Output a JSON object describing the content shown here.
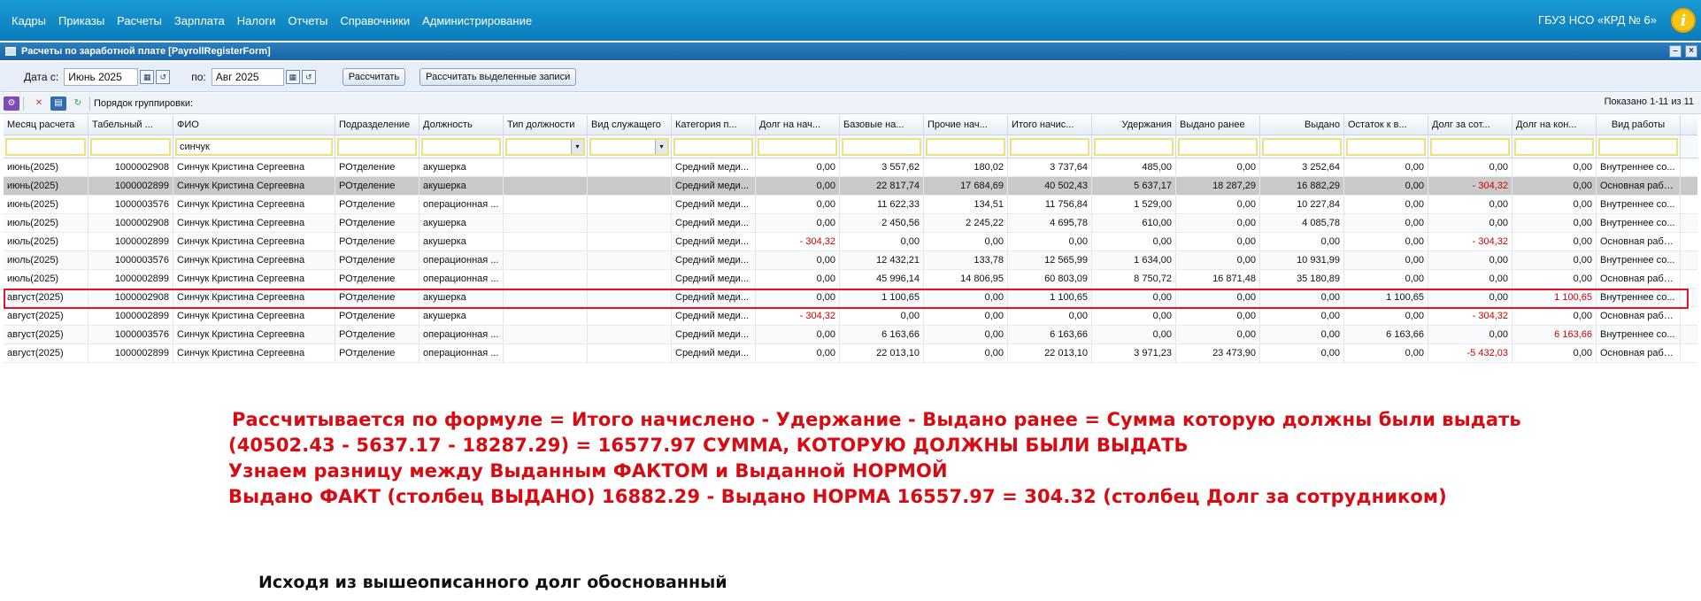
{
  "topbar": {
    "menu": [
      "Кадры",
      "Приказы",
      "Расчеты",
      "Зарплата",
      "Налоги",
      "Отчеты",
      "Справочники",
      "Администрирование"
    ],
    "org": "ГБУЗ НСО «КРД № 6»",
    "info_icon": "i"
  },
  "window": {
    "title": "Расчеты по заработной плате [PayrollRegisterForm]",
    "minimize": "–",
    "close": "×"
  },
  "filters": {
    "date_from_label": "Дата с:",
    "date_from": "Июнь 2025",
    "date_to_label": "по:",
    "date_to": "Авг 2025",
    "calc_button": "Рассчитать",
    "calc_selected_button": "Рассчитать выделенные записи"
  },
  "gridbar": {
    "group_label": "Порядок группировки:",
    "shown": "Показано 1-11 из 11"
  },
  "columns": [
    "Месяц расчета",
    "Табельный ...",
    "ФИО",
    "Подразделение",
    "Должность",
    "Тип должности",
    "Вид служащего",
    "Категория п...",
    "Долг на нач...",
    "Базовые на...",
    "Прочие нач...",
    "Итого начис...",
    "Удержания",
    "Выдано ранее",
    "Выдано",
    "Остаток к в...",
    "Долг за сот...",
    "Долг на кон...",
    "Вид работы"
  ],
  "filter_values": [
    "",
    "",
    "синчук",
    "",
    "",
    "",
    "",
    "",
    "",
    "",
    "",
    "",
    "",
    "",
    "",
    "",
    "",
    "",
    ""
  ],
  "rows": [
    [
      "июнь(2025)",
      "1000002908",
      "Синчук Кристина Сергеевна",
      "РОтделение",
      "акушерка",
      "",
      "",
      "Средний меди...",
      "0,00",
      "3 557,62",
      "180,02",
      "3 737,64",
      "485,00",
      "0,00",
      "3 252,64",
      "0,00",
      "0,00",
      "0,00",
      "Внутреннее со..."
    ],
    [
      "июнь(2025)",
      "1000002899",
      "Синчук Кристина Сергеевна",
      "РОтделение",
      "акушерка",
      "",
      "",
      "Средний меди...",
      "0,00",
      "22 817,74",
      "17 684,69",
      "40 502,43",
      "5 637,17",
      "18 287,29",
      "16 882,29",
      "0,00",
      "- 304,32",
      "0,00",
      "Основная рабо..."
    ],
    [
      "июнь(2025)",
      "1000003576",
      "Синчук Кристина Сергеевна",
      "РОтделение",
      "операционная ...",
      "",
      "",
      "Средний меди...",
      "0,00",
      "11 622,33",
      "134,51",
      "11 756,84",
      "1 529,00",
      "0,00",
      "10 227,84",
      "0,00",
      "0,00",
      "0,00",
      "Внутреннее со..."
    ],
    [
      "июль(2025)",
      "1000002908",
      "Синчук Кристина Сергеевна",
      "РОтделение",
      "акушерка",
      "",
      "",
      "Средний меди...",
      "0,00",
      "2 450,56",
      "2 245,22",
      "4 695,78",
      "610,00",
      "0,00",
      "4 085,78",
      "0,00",
      "0,00",
      "0,00",
      "Внутреннее со..."
    ],
    [
      "июль(2025)",
      "1000002899",
      "Синчук Кристина Сергеевна",
      "РОтделение",
      "акушерка",
      "",
      "",
      "Средний меди...",
      "- 304,32",
      "0,00",
      "0,00",
      "0,00",
      "0,00",
      "0,00",
      "0,00",
      "0,00",
      "- 304,32",
      "0,00",
      "Основная рабо..."
    ],
    [
      "июль(2025)",
      "1000003576",
      "Синчук Кристина Сергеевна",
      "РОтделение",
      "операционная ...",
      "",
      "",
      "Средний меди...",
      "0,00",
      "12 432,21",
      "133,78",
      "12 565,99",
      "1 634,00",
      "0,00",
      "10 931,99",
      "0,00",
      "0,00",
      "0,00",
      "Внутреннее со..."
    ],
    [
      "июль(2025)",
      "1000002899",
      "Синчук Кристина Сергеевна",
      "РОтделение",
      "операционная ...",
      "",
      "",
      "Средний меди...",
      "0,00",
      "45 996,14",
      "14 806,95",
      "60 803,09",
      "8 750,72",
      "16 871,48",
      "35 180,89",
      "0,00",
      "0,00",
      "0,00",
      "Основная рабо..."
    ],
    [
      "август(2025)",
      "1000002908",
      "Синчук Кристина Сергеевна",
      "РОтделение",
      "акушерка",
      "",
      "",
      "Средний меди...",
      "0,00",
      "1 100,65",
      "0,00",
      "1 100,65",
      "0,00",
      "0,00",
      "0,00",
      "1 100,65",
      "0,00",
      "1 100,65",
      "Внутреннее со..."
    ],
    [
      "август(2025)",
      "1000002899",
      "Синчук Кристина Сергеевна",
      "РОтделение",
      "акушерка",
      "",
      "",
      "Средний меди...",
      "- 304,32",
      "0,00",
      "0,00",
      "0,00",
      "0,00",
      "0,00",
      "0,00",
      "0,00",
      "- 304,32",
      "0,00",
      "Основная рабо..."
    ],
    [
      "август(2025)",
      "1000003576",
      "Синчук Кристина Сергеевна",
      "РОтделение",
      "операционная ...",
      "",
      "",
      "Средний меди...",
      "0,00",
      "6 163,66",
      "0,00",
      "6 163,66",
      "0,00",
      "0,00",
      "0,00",
      "6 163,66",
      "0,00",
      "6 163,66",
      "Внутреннее со..."
    ],
    [
      "август(2025)",
      "1000002899",
      "Синчук Кристина Сергеевна",
      "РОтделение",
      "операционная ...",
      "",
      "",
      "Средний меди...",
      "0,00",
      "22 013,10",
      "0,00",
      "22 013,10",
      "3 971,23",
      "23 473,90",
      "0,00",
      "0,00",
      "-5 432,03",
      "0,00",
      "Основная рабо..."
    ]
  ],
  "annotations": [
    "Рассчитывается по формуле = Итого начислено - Удержание - Выдано ранее = Сумма которую должны были выдать",
    "(40502.43 - 5637.17 - 18287.29) = 16577.97 СУММА, КОТОРУЮ ДОЛЖНЫ БЫЛИ ВЫДАТЬ",
    "Узнаем разницу между Выданным ФАКТОМ и Выданной НОРМОЙ",
    "Выдано ФАКТ (столбец ВЫДАНО)  16882.29 - Выдано НОРМА 16557.97 = 304.32 (столбец Долг за сотрудником)"
  ],
  "conclusion": "Исходя из вышеописанного долг обоснованный",
  "colors": {
    "accent": "#0a7bb8",
    "negative": "#d00000",
    "highlight": "#e0142b",
    "annotation": "#d80a12"
  }
}
